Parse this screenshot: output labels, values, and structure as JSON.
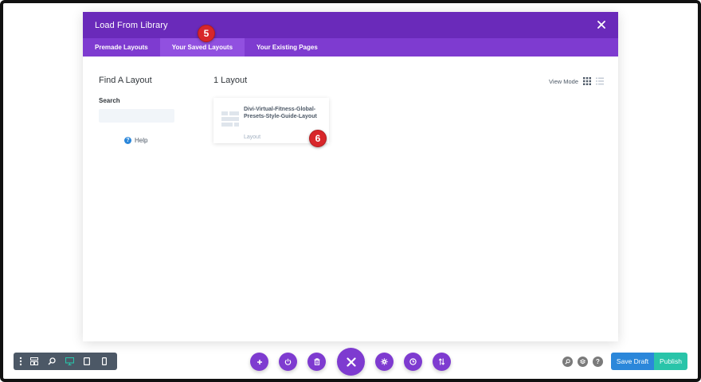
{
  "modal": {
    "title": "Load From Library",
    "tabs": [
      {
        "label": "Premade Layouts",
        "active": false
      },
      {
        "label": "Your Saved Layouts",
        "active": true
      },
      {
        "label": "Your Existing Pages",
        "active": false
      }
    ]
  },
  "sidebar": {
    "title": "Find A Layout",
    "search_label": "Search",
    "search_value": "",
    "help_label": "Help",
    "help_icon": "?"
  },
  "main": {
    "count_title": "1 Layout",
    "view_mode_label": "View Mode"
  },
  "layouts": [
    {
      "name": "Divi-Virtual-Fitness-Global-Presets-Style-Guide-Layout",
      "type": "Layout"
    }
  ],
  "badges": {
    "step5": "5",
    "step6": "6"
  },
  "bottom_bar": {
    "save_draft_label": "Save Draft",
    "publish_label": "Publish",
    "help_glyph": "?"
  },
  "colors": {
    "header": "#6a2aba",
    "tabs": "#7e3bd0",
    "active_tab": "#9150e0",
    "badge": "#d8262a",
    "save_draft": "#2b87da",
    "publish": "#29c4a9",
    "toolbar": "#4c5866"
  },
  "icons": {
    "modal_close": "close-icon",
    "grid_view": "grid-view-icon",
    "list_view": "list-view-icon",
    "left_toolbar": [
      "menu-dots-icon",
      "wireframe-icon",
      "zoom-icon",
      "desktop-icon",
      "tablet-icon",
      "phone-icon"
    ],
    "center_toolbar": [
      "add-icon",
      "power-icon",
      "trash-icon",
      "close-icon",
      "settings-icon",
      "history-icon",
      "portability-icon"
    ],
    "right_icons": [
      "search-icon",
      "layers-icon",
      "help-icon"
    ]
  }
}
